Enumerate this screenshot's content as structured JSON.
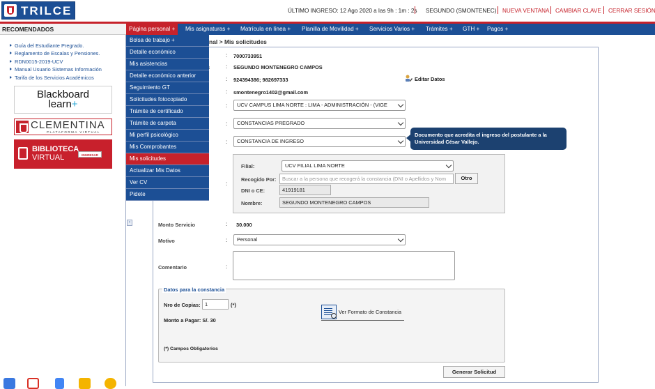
{
  "header": {
    "logo_text": "TRILCE",
    "last_login": "ÚLTIMO INGRESO: 12 Ago 2020 a las 9h : 1m : 2s",
    "user": "SEGUNDO (SMONTENEC)",
    "new_window": "NUEVA VENTANA",
    "change_password": "CAMBIAR CLAVE",
    "logout": "CERRAR SESIÓN"
  },
  "nav": {
    "items": [
      "Página personal +",
      "Mis asignaturas +",
      "Matrícula en línea +",
      "Planilla de Movilidad +",
      "Servicios Varios +",
      "Trámites +",
      "GTH +",
      "Pagos +"
    ]
  },
  "dropdown": {
    "items": [
      "Bolsa de trabajo +",
      "Detalle económico",
      "Mis asistencias",
      "Detalle económico anterior",
      "Seguimiento GT",
      "Solicitudes fotocopiado",
      "Trámite de certificado",
      "Trámite de carpeta",
      "Mi perfil psicológico",
      "Mis Comprobantes",
      "Mis solicitudes",
      "Actualizar Mis Datos",
      "Ver CV",
      "Pidete"
    ]
  },
  "sidebar": {
    "title": "RECOMENDADOS",
    "links": [
      "Guía del Estudiante Pregrado.",
      "Reglamento de Escalas y Pensiones.",
      "RDN0015-2019-UCV",
      "Manual Usuario Sistemas Información",
      "Tarifa de los Servicios Académicos"
    ],
    "blackboard": {
      "line1": "Blackboard",
      "line2": "learn",
      "plus": "+"
    },
    "clementina": {
      "name": "CLEMENTINA",
      "sub": "PLATAFORMA VIRTUAL"
    },
    "biblioteca": {
      "line1": "BIBLIOTECA",
      "line2": "VIRTUAL",
      "button": "INGRESAR"
    }
  },
  "breadcrumb": "nal > Mis solicitudes",
  "form": {
    "code": "7000733951",
    "name": "SEGUNDO MONTENEGRO CAMPOS",
    "phones": "924394386; 982697333",
    "email": "smontenegro1402@gmail.com",
    "edit_button": "Editar Datos",
    "campus_select": "UCV CAMPUS LIMA NORTE : LIMA - ADMINISTRACIÓN - (VIGE",
    "type_select": "CONSTANCIAS PREGRADO",
    "document_select": "CONSTANCIA DE INGRESO",
    "tooltip": "Documento que acredita el ingreso del postulante a la Universidad César Vallejo.",
    "filial_label": "Filial:",
    "filial_select": "UCV FILIAL LIMA NORTE",
    "recogido_label": "Recogido Por:",
    "recogido_placeholder": "Buscar a la persona que recogerá la constancia (DNI o Apellidos y Nom",
    "otro_button": "Otro",
    "dni_label": "DNI o CE:",
    "dni_value": "41919181",
    "nombre_label": "Nombre:",
    "nombre_value": "SEGUNDO MONTENEGRO CAMPOS",
    "monto_label": "Monto Servicio",
    "monto_value": "30.000",
    "motivo_label": "Motivo",
    "motivo_select": "Personal",
    "comentario_label": "Comentario",
    "datos_legend": "Datos para la constancia",
    "copias_label": "Nro de Copias:",
    "copias_value": "1",
    "required_mark": "(*)",
    "monto_pagar": "Monto a Pagar: S/. 30",
    "formato_link": "Ver Formato de Constancia",
    "obligatorios": "(*) Campos Obligatorios",
    "submit_button": "Generar Solicitud",
    "colon": ":",
    "partial_label": "s"
  },
  "colors": {
    "brand_blue": "#1c4f95",
    "brand_red": "#c6222b",
    "tooltip_bg": "#1c4170"
  }
}
